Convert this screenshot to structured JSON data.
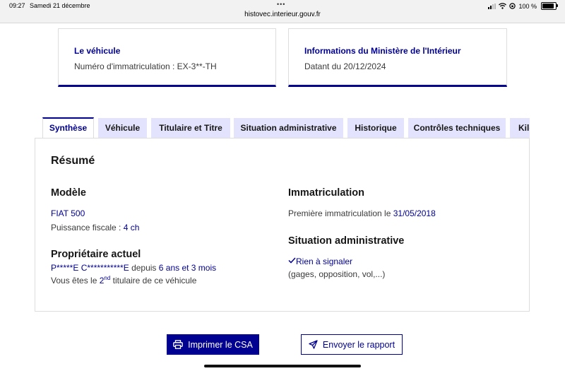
{
  "status_bar": {
    "time": "09:27",
    "date": "Samedi 21 décembre",
    "dots": "•••",
    "url": "histovec.interieur.gouv.fr",
    "battery": "100 %",
    "battery_level": 1.0
  },
  "vehicle_card": {
    "title": "Le véhicule",
    "plate_label": "Numéro d'immatriculation : ",
    "plate_value": "EX-3**-TH"
  },
  "ministry_card": {
    "title": "Informations du Ministère de l'Intérieur",
    "date_prefix": "Datant du ",
    "date": "20/12/2024"
  },
  "tabs": [
    {
      "label": "Synthèse",
      "active": true
    },
    {
      "label": "Véhicule",
      "active": false
    },
    {
      "label": "Titulaire et Titre",
      "active": false
    },
    {
      "label": "Situation administrative",
      "active": false
    },
    {
      "label": "Historique",
      "active": false
    },
    {
      "label": "Contrôles techniques",
      "active": false
    },
    {
      "label": "Kilométrage",
      "active": false
    }
  ],
  "summary": {
    "heading": "Résumé",
    "model": {
      "heading": "Modèle",
      "name": "FIAT 500",
      "power_label": "Puissance fiscale : ",
      "power_value": "4 ch"
    },
    "owner": {
      "heading": "Propriétaire actuel",
      "name": "P*****E C***********E",
      "since_label": " depuis ",
      "duration": "6 ans et 3 mois",
      "rank_prefix": "Vous êtes le ",
      "rank_number": "2",
      "rank_suffix": "nd",
      "rank_end": " titulaire de ce véhicule"
    },
    "registration": {
      "heading": "Immatriculation",
      "first_label": "Première immatriculation le ",
      "first_date": "31/05/2018"
    },
    "admin": {
      "heading": "Situation administrative",
      "status": "Rien à signaler",
      "details": "(gages, opposition, vol,...)"
    }
  },
  "actions": {
    "print_label": "Imprimer le CSA",
    "send_label": "Envoyer le rapport"
  },
  "colors": {
    "accent": "#000091",
    "tab_bg": "#e3e3fd"
  }
}
